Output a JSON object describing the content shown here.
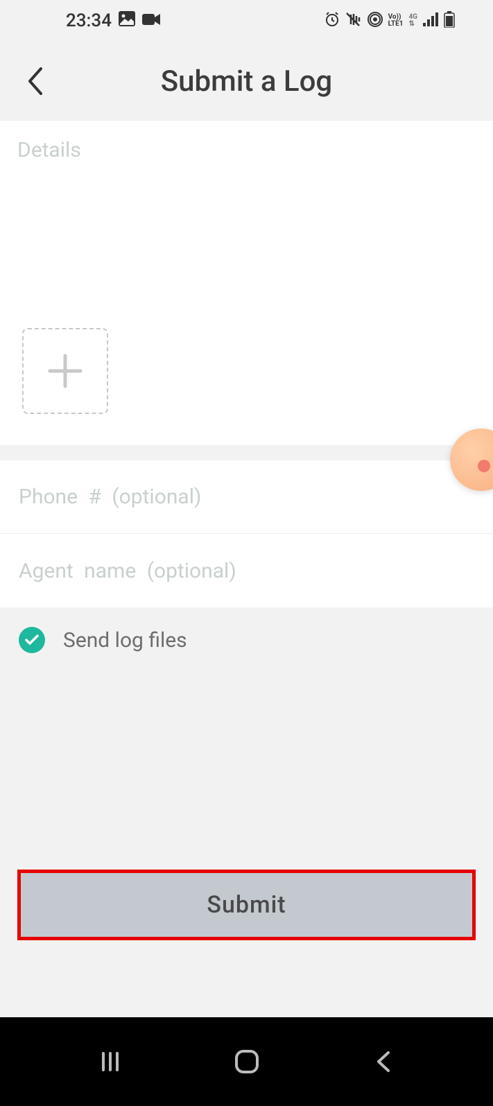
{
  "status": {
    "time": "23:34"
  },
  "header": {
    "title": "Submit a Log"
  },
  "form": {
    "details_placeholder": "Details",
    "phone_placeholder": "Phone # (optional)",
    "agent_placeholder": "Agent name (optional)",
    "send_log_label": "Send log files",
    "submit_label": "Submit"
  }
}
